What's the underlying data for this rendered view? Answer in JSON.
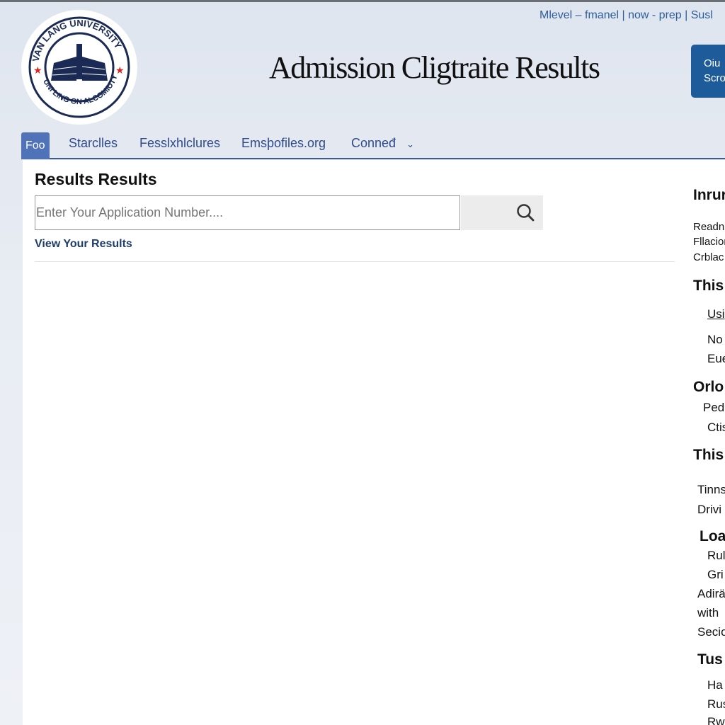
{
  "header": {
    "logo_text": [
      "VAN LANG UNIVERSITY",
      "UNI LING ON ALCOMIUTY"
    ],
    "utility_links": "Mlevel – fmanel | now - prep | Susl",
    "title": "Admission Cligtraite Results",
    "cta_label": [
      "Oiu",
      "Scro"
    ],
    "brand_color": "#1d5b9b"
  },
  "nav": {
    "items": [
      {
        "label": "Foo",
        "active": true
      },
      {
        "label": "Starclles"
      },
      {
        "label": "Fesslxhlclures"
      },
      {
        "label": "Emsþofiles.org"
      },
      {
        "label": "Conneđ",
        "dropdown": true
      }
    ]
  },
  "main": {
    "heading": "Results Results",
    "search": {
      "placeholder": "Enter Your Application Number....",
      "icon": "search-icon"
    },
    "view_link": "View Your Results"
  },
  "sidebar": {
    "items": [
      {
        "text": "Inrur",
        "type": "heading"
      },
      {
        "text": "Readn",
        "type": "small"
      },
      {
        "text": "Fllacion",
        "type": "small"
      },
      {
        "text": "Crblac",
        "type": "small"
      },
      {
        "text": "This",
        "type": "heading"
      },
      {
        "text": "Usi",
        "type": "link"
      },
      {
        "text": "No",
        "type": "text"
      },
      {
        "text": "Eue",
        "type": "text"
      },
      {
        "text": "Orlo",
        "type": "heading"
      },
      {
        "text": "Ped",
        "type": "text"
      },
      {
        "text": "Ctis",
        "type": "text"
      },
      {
        "text": "This",
        "type": "heading"
      },
      {
        "text": "Tinns",
        "type": "text"
      },
      {
        "text": "Drivi",
        "type": "text"
      },
      {
        "text": "Loa",
        "type": "heading"
      },
      {
        "text": "Rul",
        "type": "text"
      },
      {
        "text": "Gri",
        "type": "text"
      },
      {
        "text": "Adirä",
        "type": "text"
      },
      {
        "text": "with",
        "type": "text"
      },
      {
        "text": "Secio",
        "type": "text"
      },
      {
        "text": "Tus",
        "type": "heading"
      },
      {
        "text": "Ha",
        "type": "text"
      },
      {
        "text": "Rus",
        "type": "text"
      },
      {
        "text": "Rw",
        "type": "text"
      }
    ]
  }
}
